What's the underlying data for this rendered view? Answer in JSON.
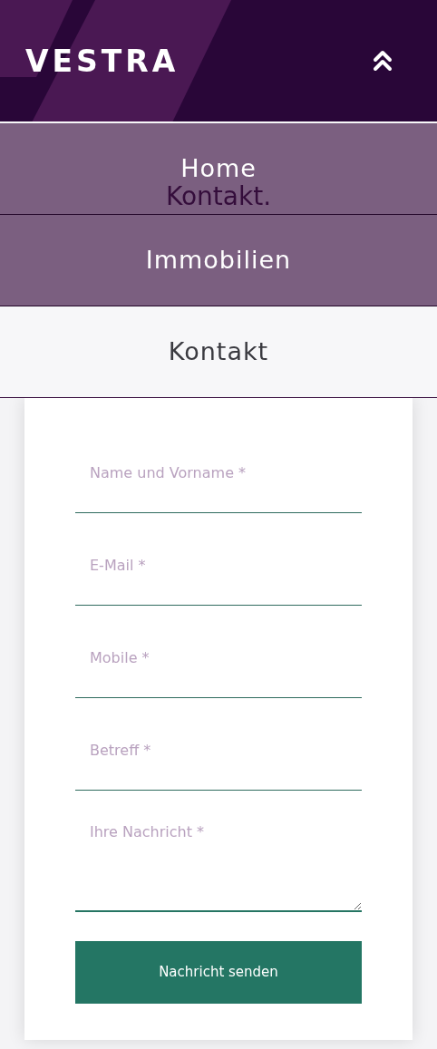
{
  "header": {
    "logo": "VESTRA"
  },
  "menu": {
    "expanded": true,
    "items": [
      {
        "label": "Home",
        "selected": false
      },
      {
        "label": "Immobilien",
        "selected": false
      },
      {
        "label": "Kontakt",
        "selected": true
      }
    ]
  },
  "page_title": "Kontakt.",
  "form": {
    "fields": [
      {
        "kind": "input",
        "placeholder": "Name und Vorname *"
      },
      {
        "kind": "input",
        "placeholder": "E-Mail *"
      },
      {
        "kind": "input",
        "placeholder": "Mobile *"
      },
      {
        "kind": "input",
        "placeholder": "Betreff *"
      },
      {
        "kind": "textarea",
        "placeholder": "Ihre Nachricht *"
      }
    ],
    "submit": "Nachricht senden"
  }
}
